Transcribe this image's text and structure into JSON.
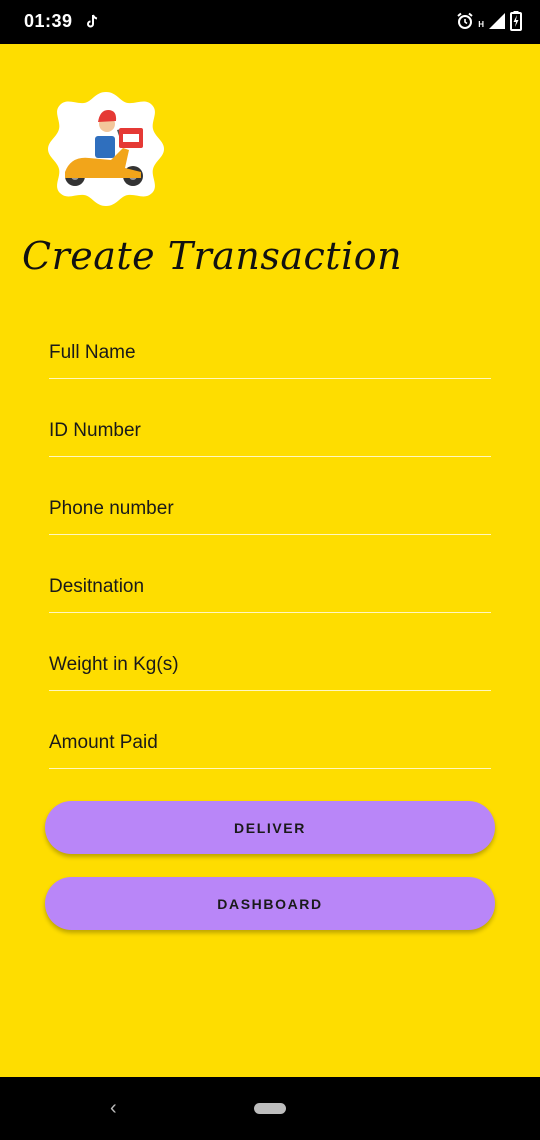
{
  "status_bar": {
    "time": "01:39",
    "network_label": "H",
    "icons": [
      "tiktok-icon",
      "alarm-icon",
      "signal-icon",
      "battery-charging-icon"
    ]
  },
  "app": {
    "logo": "delivery-scooter-logo",
    "title": "Create Transaction"
  },
  "form": {
    "fields": [
      {
        "placeholder": "Full Name",
        "value": ""
      },
      {
        "placeholder": "ID Number",
        "value": ""
      },
      {
        "placeholder": "Phone number",
        "value": ""
      },
      {
        "placeholder": "Desitnation",
        "value": ""
      },
      {
        "placeholder": "Weight in Kg(s)",
        "value": ""
      },
      {
        "placeholder": "Amount Paid",
        "value": ""
      }
    ]
  },
  "buttons": {
    "deliver": "DELIVER",
    "dashboard": "DASHBOARD"
  },
  "colors": {
    "background": "#fedd00",
    "button": "#b986f8",
    "status_bar": "#000000"
  },
  "nav_bar": {
    "icons": [
      "back-icon",
      "home-pill-icon"
    ]
  }
}
